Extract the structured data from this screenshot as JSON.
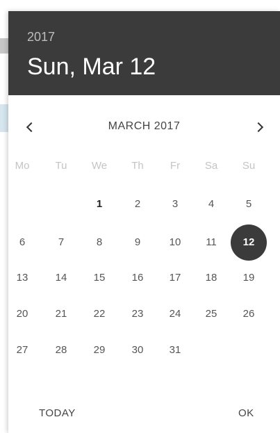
{
  "header": {
    "year": "2017",
    "selected_date": "Sun, Mar 12"
  },
  "nav": {
    "month_label": "MARCH 2017",
    "prev_icon": "chevron-left-icon",
    "next_icon": "chevron-right-icon"
  },
  "weekdays": [
    "Mo",
    "Tu",
    "We",
    "Th",
    "Fr",
    "Sa",
    "Su"
  ],
  "weeks": [
    [
      "",
      "",
      "1",
      "2",
      "3",
      "4",
      "5"
    ],
    [
      "6",
      "7",
      "8",
      "9",
      "10",
      "11",
      "12"
    ],
    [
      "13",
      "14",
      "15",
      "16",
      "17",
      "18",
      "19"
    ],
    [
      "20",
      "21",
      "22",
      "23",
      "24",
      "25",
      "26"
    ],
    [
      "27",
      "28",
      "29",
      "30",
      "31",
      "",
      ""
    ]
  ],
  "selected_day": "12",
  "bold_day": "1",
  "actions": {
    "today_label": "TODAY",
    "ok_label": "OK"
  },
  "colors": {
    "header_bg": "#3b3b3b",
    "selected_bg": "#3b3b3b",
    "weekday_text": "#c4c4c4"
  }
}
